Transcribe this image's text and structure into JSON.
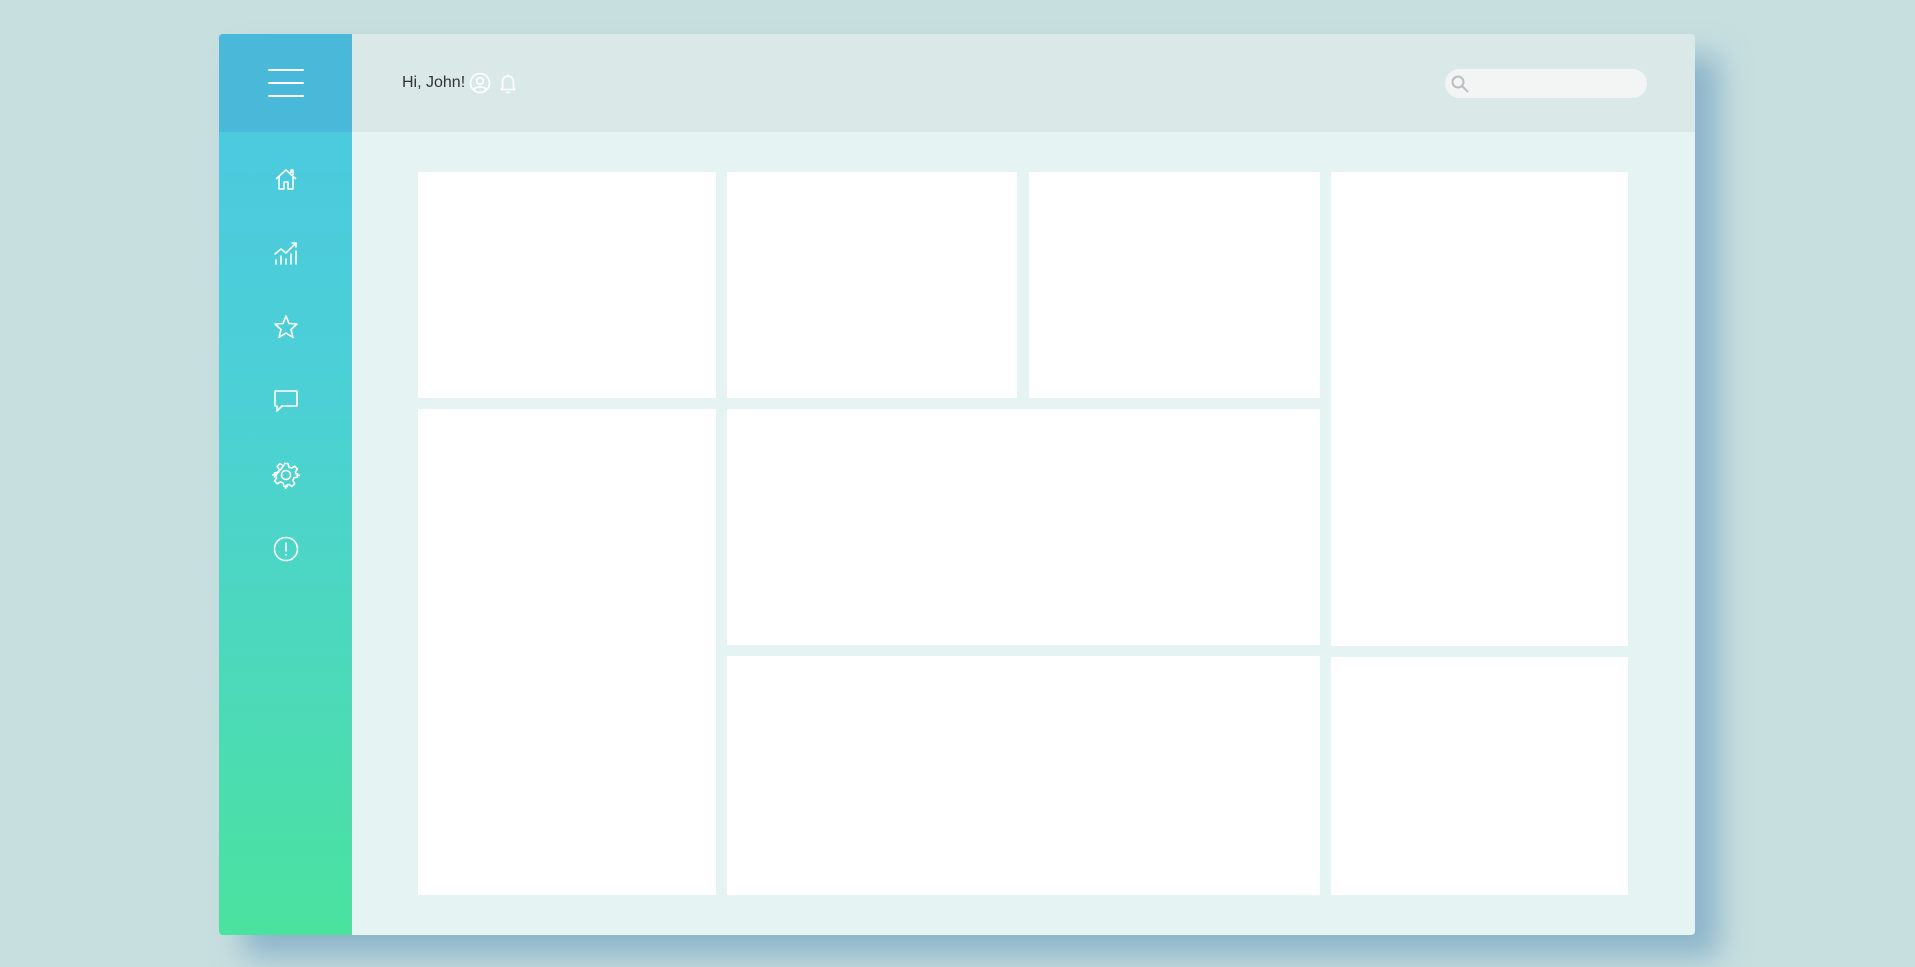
{
  "header": {
    "greeting": "Hi, John!",
    "search_placeholder": ""
  },
  "sidebar": {
    "menu_icon": "hamburger-menu-icon",
    "items": [
      {
        "icon": "home-icon"
      },
      {
        "icon": "analytics-icon"
      },
      {
        "icon": "star-icon"
      },
      {
        "icon": "chat-icon"
      },
      {
        "icon": "settings-icon"
      },
      {
        "icon": "info-icon"
      }
    ]
  },
  "colors": {
    "sidebar_top": "#4ab9d9",
    "sidebar_gradient_start": "#4cc7e2",
    "sidebar_gradient_end": "#4be29f",
    "header_bg": "#dae8e8",
    "content_bg": "#e6f3f3",
    "card_bg": "#ffffff"
  }
}
